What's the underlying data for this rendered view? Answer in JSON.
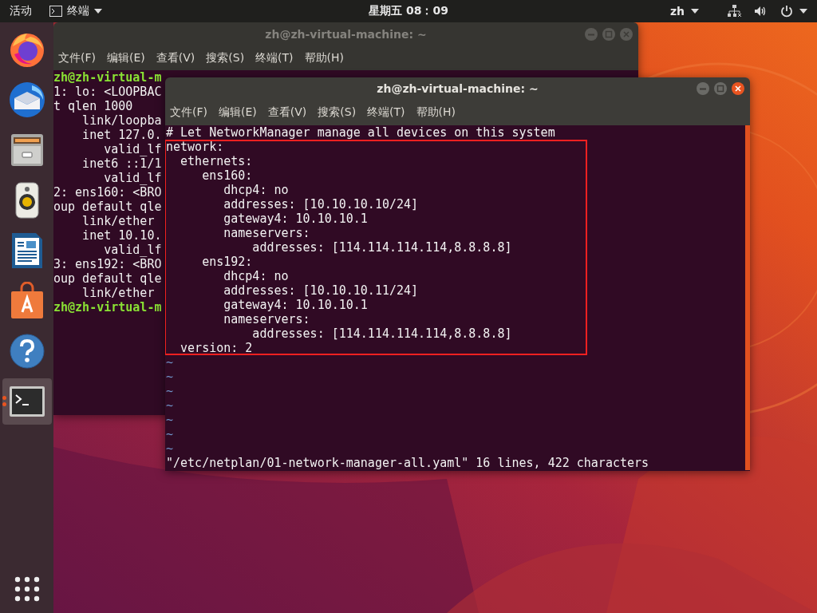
{
  "top_bar": {
    "activities": "活动",
    "app_menu": "终端",
    "clock": "星期五 08：09",
    "language": "zh"
  },
  "dock": {
    "items": [
      {
        "kind": "firefox",
        "selected": false
      },
      {
        "kind": "mail",
        "selected": false
      },
      {
        "kind": "files",
        "selected": false
      },
      {
        "kind": "speaker",
        "selected": false
      },
      {
        "kind": "document",
        "selected": false
      },
      {
        "kind": "store",
        "selected": false
      },
      {
        "kind": "help",
        "selected": false
      },
      {
        "kind": "terminal",
        "selected": true
      }
    ]
  },
  "back_window": {
    "title": "zh@zh-virtual-machine: ~",
    "active": false,
    "menu": [
      "文件(F)",
      "编辑(E)",
      "查看(V)",
      "搜索(S)",
      "终端(T)",
      "帮助(H)"
    ],
    "lines": [
      {
        "kind": "prompt",
        "text": "zh@zh-virtual-m"
      },
      {
        "kind": "output",
        "text": "1: lo: <LOOPBAC"
      },
      {
        "kind": "output",
        "text": "t qlen 1000"
      },
      {
        "kind": "output",
        "text": "    link/loopba"
      },
      {
        "kind": "output",
        "text": "    inet 127.0."
      },
      {
        "kind": "output",
        "text": "       valid_lf"
      },
      {
        "kind": "output",
        "text": "    inet6 ::1/1"
      },
      {
        "kind": "output",
        "text": "       valid_lf"
      },
      {
        "kind": "output",
        "text": "2: ens160: <BRO"
      },
      {
        "kind": "output",
        "text": "oup default qle"
      },
      {
        "kind": "output",
        "text": "    link/ether"
      },
      {
        "kind": "output",
        "text": "    inet 10.10."
      },
      {
        "kind": "output",
        "text": "       valid_lf"
      },
      {
        "kind": "output",
        "text": "3: ens192: <BRO"
      },
      {
        "kind": "output",
        "text": "oup default qle"
      },
      {
        "kind": "output",
        "text": "    link/ether"
      },
      {
        "kind": "prompt",
        "text": "zh@zh-virtual-m"
      }
    ]
  },
  "front_window": {
    "title": "zh@zh-virtual-machine: ~",
    "active": true,
    "menu": [
      "文件(F)",
      "编辑(E)",
      "查看(V)",
      "搜索(S)",
      "终端(T)",
      "帮助(H)"
    ],
    "lines": [
      {
        "text": "# Let NetworkManager manage all devices on this system",
        "highlighted": false
      },
      {
        "text": "network:",
        "highlighted": true
      },
      {
        "text": "  ethernets:",
        "highlighted": true
      },
      {
        "text": "     ens160:",
        "highlighted": true
      },
      {
        "text": "        dhcp4: no",
        "highlighted": true
      },
      {
        "text": "        addresses: [10.10.10.10/24]",
        "highlighted": true
      },
      {
        "text": "        gateway4: 10.10.10.1",
        "highlighted": true
      },
      {
        "text": "        nameservers:",
        "highlighted": true
      },
      {
        "text": "            addresses: [114.114.114.114,8.8.8.8]",
        "highlighted": true
      },
      {
        "text": "     ens192:",
        "highlighted": true
      },
      {
        "text": "        dhcp4: no",
        "highlighted": true
      },
      {
        "text": "        addresses: [10.10.10.11/24]",
        "highlighted": true
      },
      {
        "text": "        gateway4: 10.10.10.1",
        "highlighted": true
      },
      {
        "text": "        nameservers:",
        "highlighted": true
      },
      {
        "text": "            addresses: [114.114.114.114,8.8.8.8]",
        "highlighted": true
      },
      {
        "text": "  version: 2",
        "highlighted": true
      }
    ],
    "empty_lines": [
      "~",
      "~",
      "~",
      "~",
      "~",
      "~",
      "~"
    ],
    "status": "\"/etc/netplan/01-network-manager-all.yaml\" 16 lines, 422 characters"
  }
}
